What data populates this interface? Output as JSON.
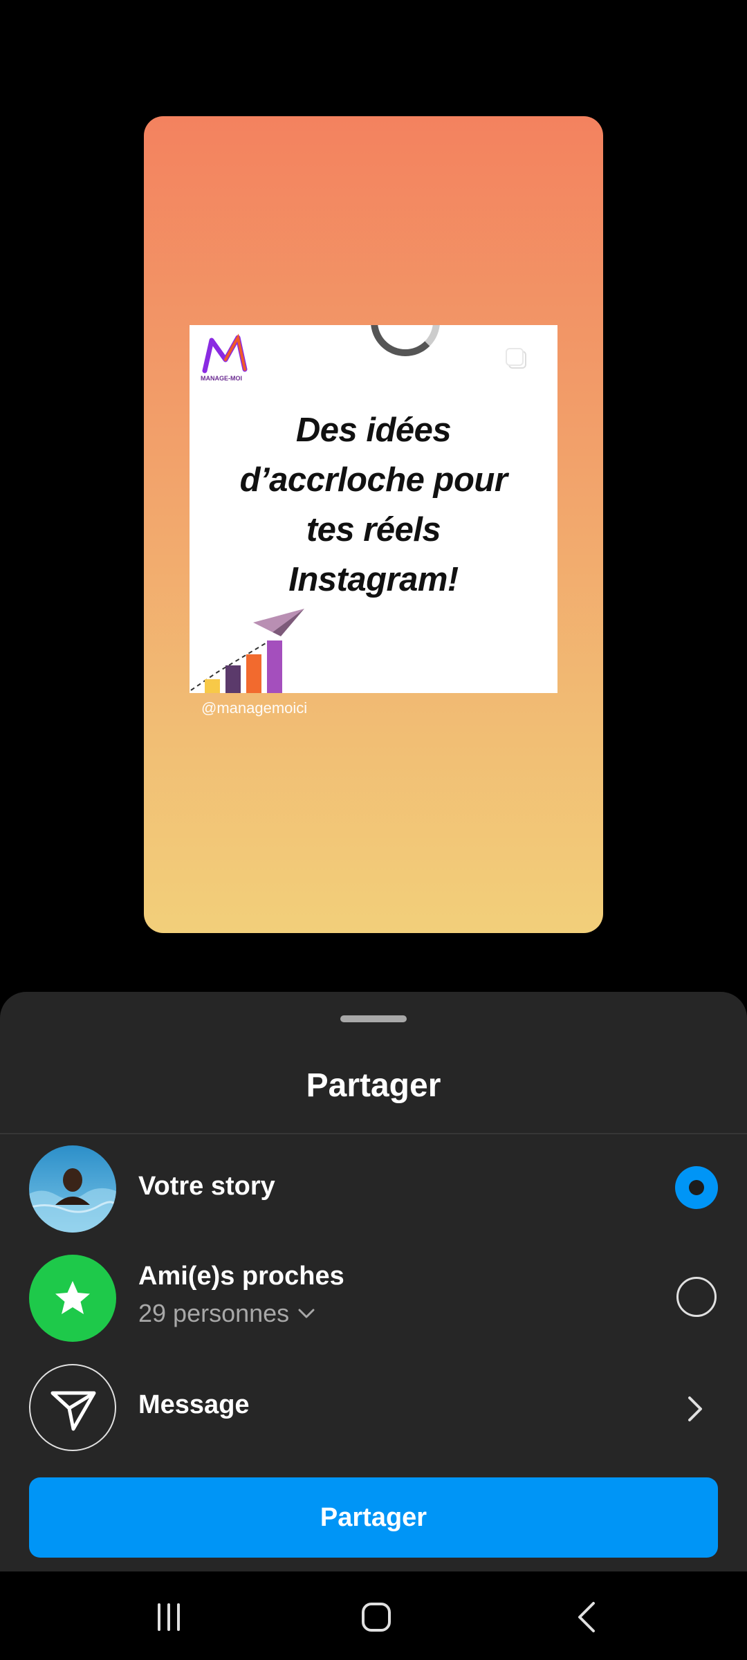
{
  "story_preview": {
    "headline": "Des idées\nd’accrloche pour\ntes réels\nInstagram!",
    "handle": "@managemoici",
    "logo_text": "MANAGE-MOI"
  },
  "sheet": {
    "title": "Partager",
    "options": [
      {
        "label": "Votre story",
        "state": "selected",
        "icon": "user-avatar"
      },
      {
        "label": "Ami(e)s proches",
        "sublabel": "29 personnes",
        "state": "unselected",
        "icon": "star-icon"
      },
      {
        "label": "Message",
        "state": "navigate",
        "icon": "paper-plane-icon"
      }
    ],
    "share_button": "Partager"
  },
  "colors": {
    "accent": "#0095f6",
    "close_friends": "#1ec94a",
    "sheet_bg": "#262626"
  },
  "navbar": {
    "icons": [
      "recents-icon",
      "home-icon",
      "back-icon"
    ]
  }
}
